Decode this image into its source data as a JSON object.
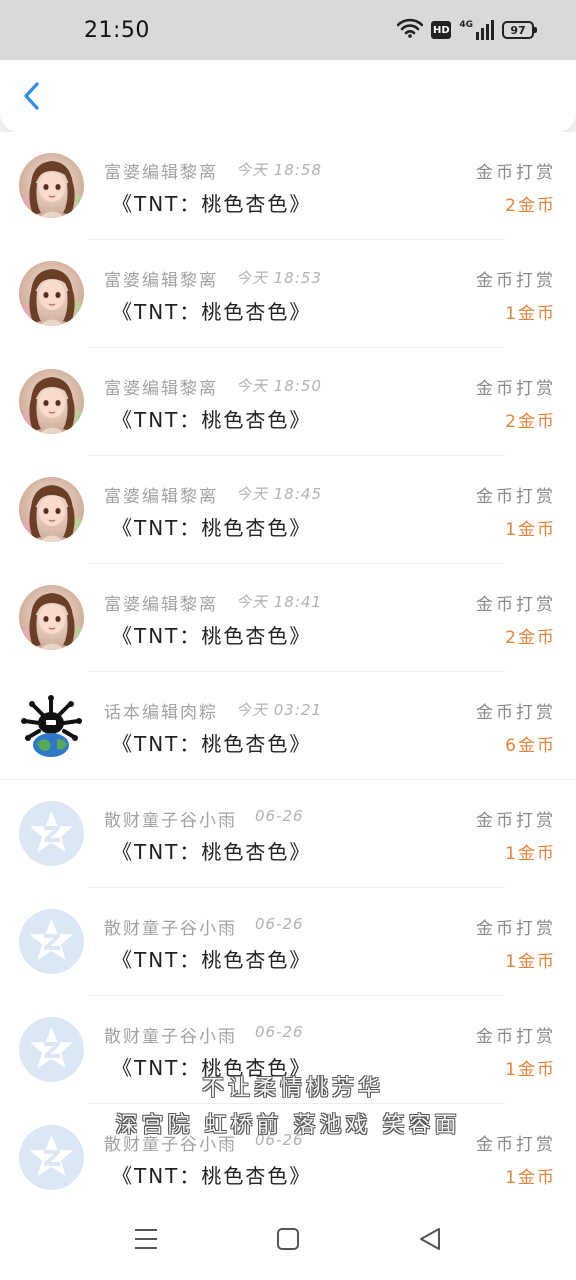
{
  "status_bar": {
    "time": "21:50",
    "network": "4G",
    "hd": "HD",
    "battery": "97",
    "icons": [
      "wifi-icon",
      "hd-icon",
      "signal-icon",
      "battery-icon"
    ]
  },
  "nav": {
    "back_icon": "chevron-left-icon",
    "accent_color": "#2f8fe6"
  },
  "records": [
    {
      "user": "富婆编辑黎离",
      "time": "今天 18:58",
      "book": "《TNT：桃色杏色》",
      "type": "金币打赏",
      "amount": "2金币",
      "avatar": "anime-girl"
    },
    {
      "user": "富婆编辑黎离",
      "time": "今天 18:53",
      "book": "《TNT：桃色杏色》",
      "type": "金币打赏",
      "amount": "1金币",
      "avatar": "anime-girl"
    },
    {
      "user": "富婆编辑黎离",
      "time": "今天 18:50",
      "book": "《TNT：桃色杏色》",
      "type": "金币打赏",
      "amount": "2金币",
      "avatar": "anime-girl"
    },
    {
      "user": "富婆编辑黎离",
      "time": "今天 18:45",
      "book": "《TNT：桃色杏色》",
      "type": "金币打赏",
      "amount": "1金币",
      "avatar": "anime-girl"
    },
    {
      "user": "富婆编辑黎离",
      "time": "今天 18:41",
      "book": "《TNT：桃色杏色》",
      "type": "金币打赏",
      "amount": "2金币",
      "avatar": "anime-girl"
    },
    {
      "user": "话本编辑肉粽",
      "time": "今天 03:21",
      "book": "《TNT：桃色杏色》",
      "type": "金币打赏",
      "amount": "6金币",
      "avatar": "globe-bones"
    },
    {
      "user": "散财童子谷小雨",
      "time": "06-26",
      "book": "《TNT：桃色杏色》",
      "type": "金币打赏",
      "amount": "1金币",
      "avatar": "default-z"
    },
    {
      "user": "散财童子谷小雨",
      "time": "06-26",
      "book": "《TNT：桃色杏色》",
      "type": "金币打赏",
      "amount": "1金币",
      "avatar": "default-z"
    },
    {
      "user": "散财童子谷小雨",
      "time": "06-26",
      "book": "《TNT：桃色杏色》",
      "type": "金币打赏",
      "amount": "1金币",
      "avatar": "default-z"
    },
    {
      "user": "散财童子谷小雨",
      "time": "06-26",
      "book": "《TNT：桃色杏色》",
      "type": "金币打赏",
      "amount": "1金币",
      "avatar": "default-z"
    }
  ],
  "watermark": {
    "line1": "不让柔情桃芳华",
    "line2": "深宫院 虹桥前 落池戏 笑容面"
  },
  "colors": {
    "amount": "#e8823a",
    "default_avatar": "#dbe7f4"
  },
  "bottom_nav": {
    "icons": [
      "menu-icon",
      "home-square-icon",
      "back-triangle-icon"
    ]
  }
}
